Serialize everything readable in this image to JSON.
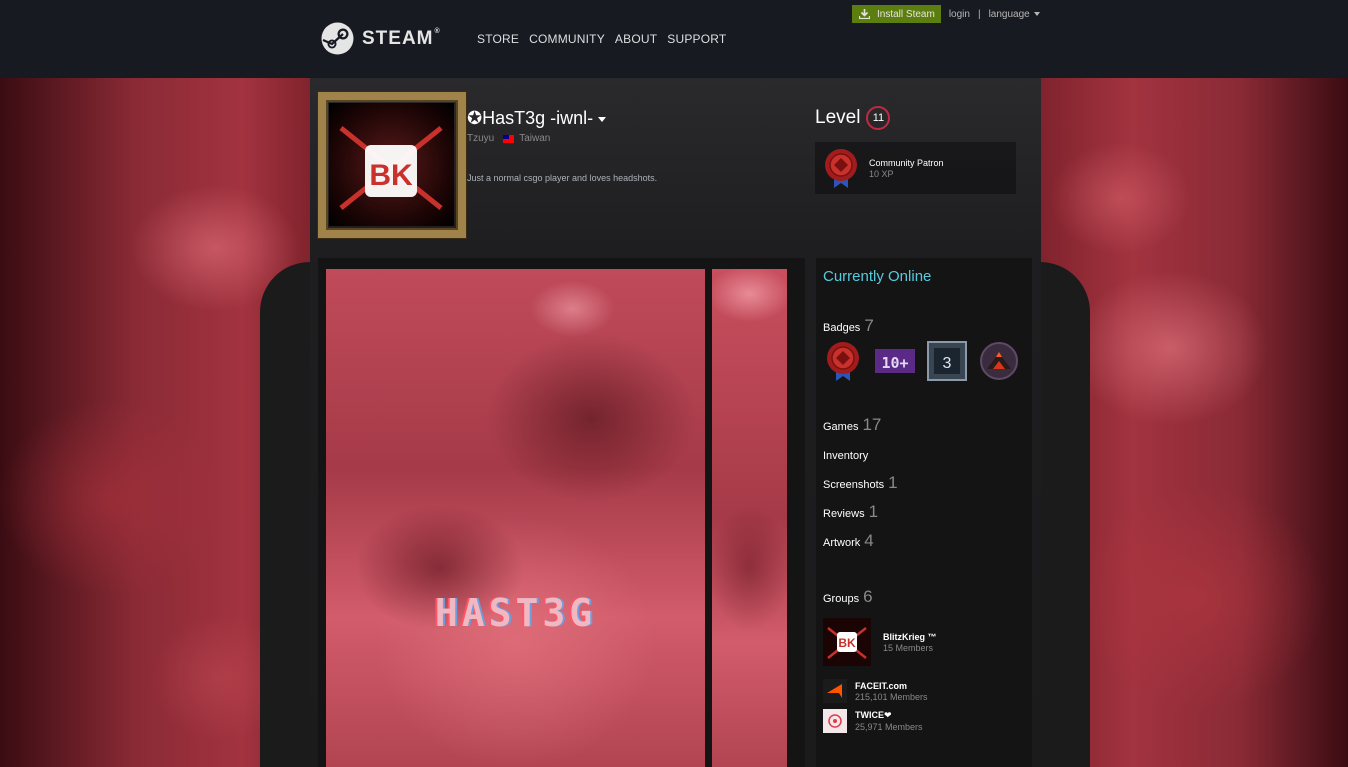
{
  "header": {
    "logo_text": "STEAM",
    "logo_mark": "®",
    "nav": [
      "STORE",
      "COMMUNITY",
      "ABOUT",
      "SUPPORT"
    ],
    "install_label": "Install Steam",
    "login_label": "login",
    "separator": "|",
    "language_label": "language"
  },
  "profile": {
    "persona_name": "✪HasT3g -iwnl-",
    "real_name": "Tzuyu",
    "country": "Taiwan",
    "summary": "Just a normal csgo player and loves headshots.",
    "avatar_text": "BK",
    "level_label": "Level",
    "level": "11",
    "favorite_badge": {
      "name": "Community Patron",
      "xp": "10 XP"
    }
  },
  "showcase": {
    "artwork_text": "HAST3G"
  },
  "sidebar": {
    "online_status": "Currently Online",
    "badges": {
      "label": "Badges",
      "count": "7",
      "icons": [
        "patron-badge-icon",
        "years-of-service-badge-icon",
        "level-3-badge-icon",
        "volcano-badge-icon"
      ],
      "years_text": "10+",
      "level3_text": "3"
    },
    "games": {
      "label": "Games",
      "count": "17"
    },
    "inventory": {
      "label": "Inventory"
    },
    "screenshots": {
      "label": "Screenshots",
      "count": "1"
    },
    "reviews": {
      "label": "Reviews",
      "count": "1"
    },
    "artwork": {
      "label": "Artwork",
      "count": "4"
    },
    "groups": {
      "label": "Groups",
      "count": "6",
      "items": [
        {
          "name": "BlitzKrieg ™",
          "members": "15 Members"
        },
        {
          "name": "FACEIT.com",
          "members": "215,101 Members"
        },
        {
          "name": "TWICE❤",
          "members": "25,971 Members"
        }
      ]
    }
  },
  "colors": {
    "header_bg": "#171a21",
    "install_green": "#5c7e10",
    "online_blue": "#57cbde",
    "level_ring": "#c02942",
    "background_red": "#a2333f"
  }
}
